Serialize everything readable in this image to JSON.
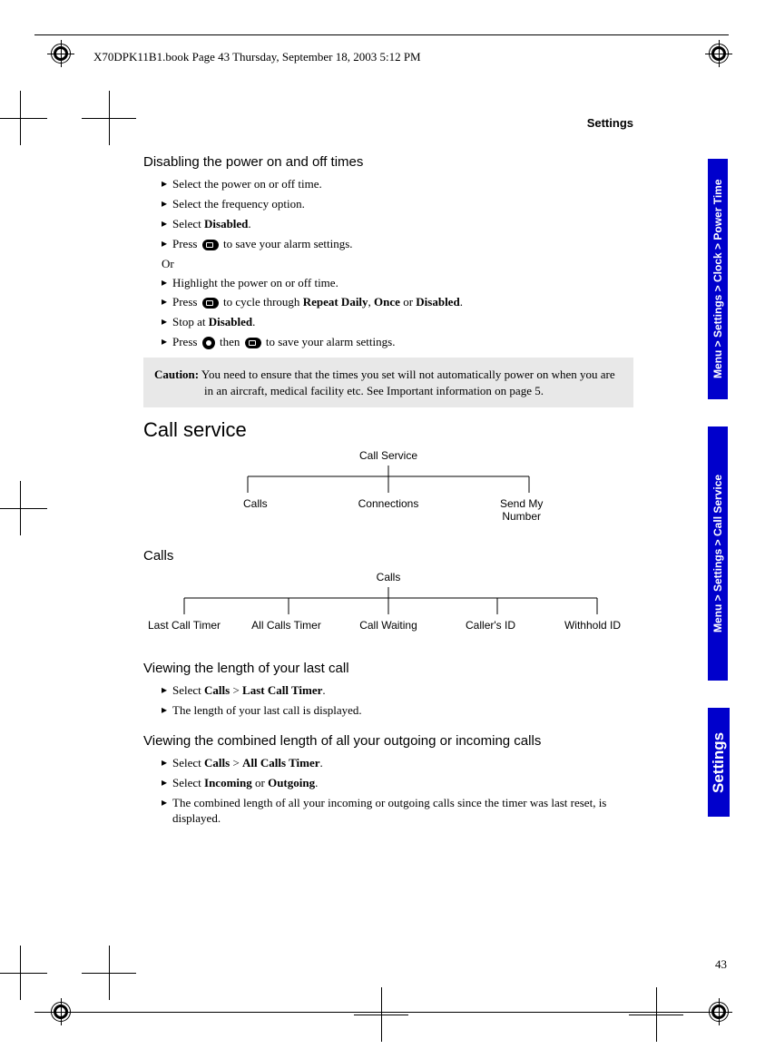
{
  "header": "X70DPK11B1.book  Page 43  Thursday, September 18, 2003  5:12 PM",
  "section_label": "Settings",
  "sidebar": {
    "tab1": "Menu > Settings > Clock > Power Time",
    "tab2": "Menu > Settings > Call Service",
    "tab3": "Settings"
  },
  "h_disable": "Disabling the power on and off times",
  "steps1": {
    "s1": "Select the power on or off time.",
    "s2": "Select the frequency option.",
    "s3_pre": "Select ",
    "s3_bold": "Disabled",
    "s3_post": ".",
    "s4_pre": "Press ",
    "s4_post": " to save your alarm settings."
  },
  "or": "Or",
  "steps2": {
    "s1": "Highlight the power on or off time.",
    "s2_pre": "Press ",
    "s2_mid": " to cycle through ",
    "s2_b1": "Repeat Daily",
    "s2_c1": ", ",
    "s2_b2": "Once",
    "s2_c2": " or ",
    "s2_b3": "Disabled",
    "s2_post": ".",
    "s3_pre": "Stop at ",
    "s3_b": "Disabled",
    "s3_post": ".",
    "s4_pre": "Press ",
    "s4_mid": " then ",
    "s4_post": " to save your alarm settings."
  },
  "caution": {
    "label": "Caution:",
    "text": " You need to ensure that the times you set will not automatically power on when you are in an aircraft, medical facility etc. See Important information on page 5."
  },
  "h_callservice": "Call service",
  "tree1": {
    "root": "Call Service",
    "leaf1": "Calls",
    "leaf2": "Connections",
    "leaf3": "Send My\nNumber"
  },
  "h_calls": "Calls",
  "tree2": {
    "root": "Calls",
    "l1": "Last Call Timer",
    "l2": "All Calls Timer",
    "l3": "Call Waiting",
    "l4": "Caller's ID",
    "l5": "Withhold ID"
  },
  "h_lastcall": "Viewing the length of your last call",
  "lastcall": {
    "s1_pre": "Select ",
    "s1_b1": "Calls",
    "s1_mid": " > ",
    "s1_b2": "Last Call Timer",
    "s1_post": ".",
    "s2": "The length of your last call is displayed."
  },
  "h_combined": "Viewing the combined length of all your outgoing or incoming calls",
  "combined": {
    "s1_pre": "Select ",
    "s1_b1": "Calls",
    "s1_mid": " > ",
    "s1_b2": "All Calls Timer",
    "s1_post": ".",
    "s2_pre": "Select ",
    "s2_b1": "Incoming",
    "s2_mid": " or ",
    "s2_b2": "Outgoing",
    "s2_post": ".",
    "s3": "The combined length of all your incoming or outgoing calls since the timer was last reset, is displayed."
  },
  "page_num": "43"
}
